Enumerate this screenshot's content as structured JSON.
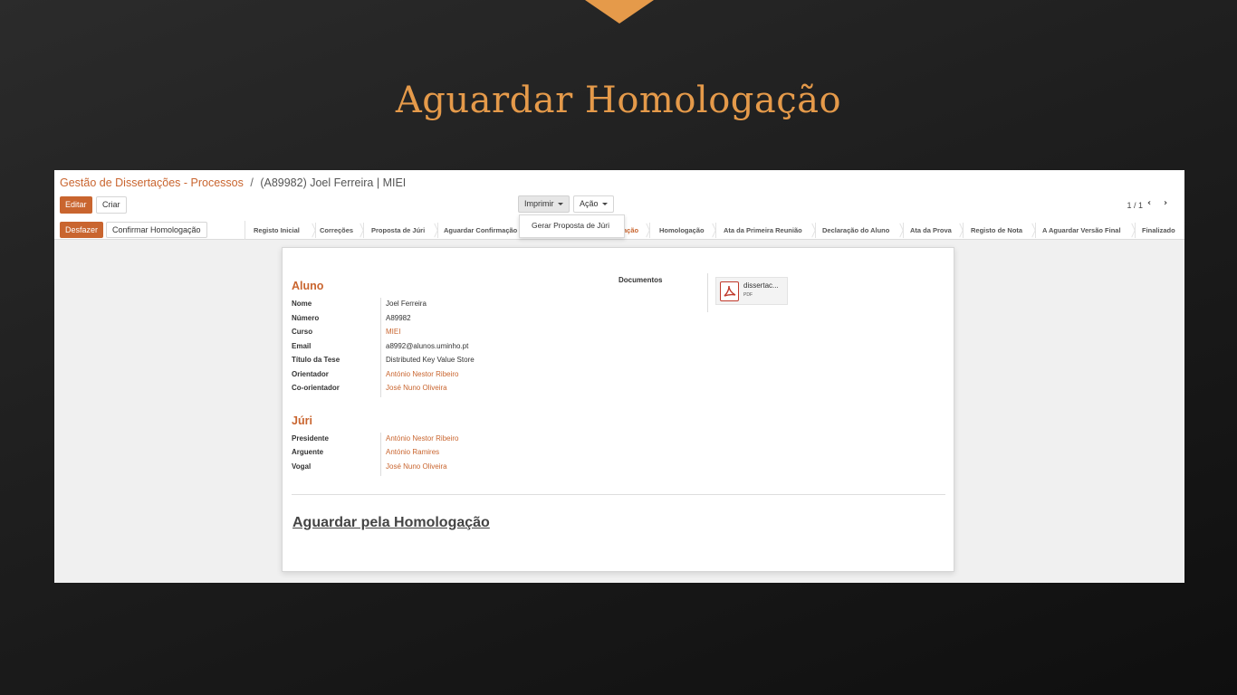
{
  "slide": {
    "title": "Aguardar Homologação",
    "accent_color": "#e59a4a"
  },
  "breadcrumb": {
    "parent": "Gestão de Dissertações - Processos",
    "separator": "/",
    "current": "(A89982) Joel Ferreira | MIEI"
  },
  "toolbar": {
    "edit_label": "Editar",
    "create_label": "Criar",
    "print_label": "Imprimir",
    "action_label": "Ação",
    "print_menu_items": [
      "Gerar Proposta de Júri"
    ],
    "pager": "1 / 1"
  },
  "statusbar": {
    "undo_label": "Desfazer",
    "confirm_label": "Confirmar Homologação",
    "steps": [
      {
        "label": "Registo Inicial",
        "active": false
      },
      {
        "label": "Correções",
        "active": false
      },
      {
        "label": "Proposta de Júri",
        "active": false
      },
      {
        "label": "Aguardar Confirmação",
        "active": false
      },
      {
        "label": "ação",
        "active": true
      },
      {
        "label": "Homologação",
        "active": false
      },
      {
        "label": "Ata da Primeira Reunião",
        "active": false
      },
      {
        "label": "Declaração do Aluno",
        "active": false
      },
      {
        "label": "Ata da Prova",
        "active": false
      },
      {
        "label": "Registo de Nota",
        "active": false
      },
      {
        "label": "A Aguardar Versão Final",
        "active": false
      },
      {
        "label": "Finalizado",
        "active": false
      }
    ]
  },
  "aluno": {
    "title": "Aluno",
    "fields": [
      {
        "label": "Nome",
        "value": "Joel Ferreira",
        "link": false
      },
      {
        "label": "Número",
        "value": "A89982",
        "link": false
      },
      {
        "label": "Curso",
        "value": "MIEI",
        "link": true
      },
      {
        "label": "Email",
        "value": "a8992@alunos.uminho.pt",
        "link": false
      },
      {
        "label": "Título da Tese",
        "value": "Distributed Key Value Store",
        "link": false
      },
      {
        "label": "Orientador",
        "value": "António Nestor Ribeiro",
        "link": true
      },
      {
        "label": "Co-orientador",
        "value": "José Nuno Oliveira",
        "link": true
      }
    ]
  },
  "juri": {
    "title": "Júri",
    "fields": [
      {
        "label": "Presidente",
        "value": "António Nestor Ribeiro",
        "link": true
      },
      {
        "label": "Arguente",
        "value": "António Ramires",
        "link": true
      },
      {
        "label": "Vogal",
        "value": "José Nuno Oliveira",
        "link": true
      }
    ]
  },
  "documentos": {
    "label": "Documentos",
    "file_name": "dissertac...",
    "file_type": "PDF",
    "icon": "pdf-icon"
  },
  "heading": "Aguardar pela Homologação",
  "colors": {
    "brand": "#c9652f"
  }
}
